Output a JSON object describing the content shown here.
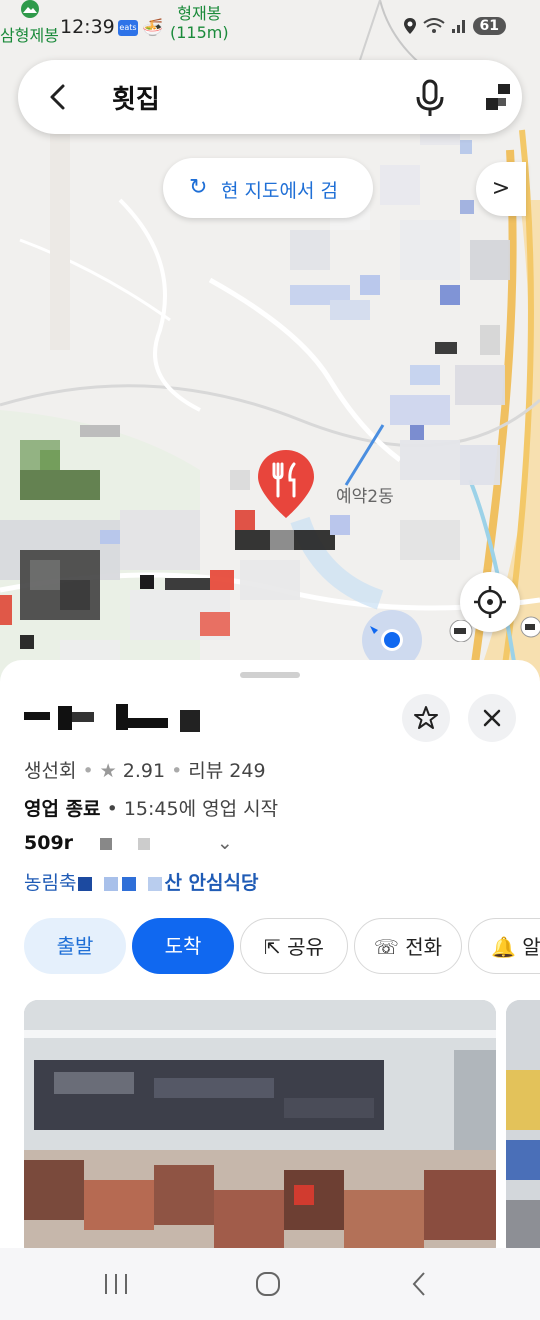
{
  "status_bar": {
    "time": "12:39",
    "peak_left_label": "삼형제봉",
    "peak_name": "형재봉",
    "peak_height": "(115m)",
    "eats_badge": "eats",
    "battery": "61"
  },
  "search": {
    "query": "횟집"
  },
  "map": {
    "research_label": "현 지도에서 검",
    "map_label": "예약2동"
  },
  "place": {
    "category": "생선회",
    "rating": "2.91",
    "reviews": "리뷰 249",
    "status": "영업 종료",
    "hours": "15:45에 영업 시작",
    "distance": "509r",
    "cert_prefix": "농림축",
    "cert_suffix": "산 안심식당"
  },
  "actions": {
    "depart": "출발",
    "arrive": "도착",
    "share": "공유",
    "call": "전화",
    "alert": "알"
  },
  "colors": {
    "accent": "#1068f0",
    "pin": "#e8453c",
    "link": "#1f5bb5"
  }
}
